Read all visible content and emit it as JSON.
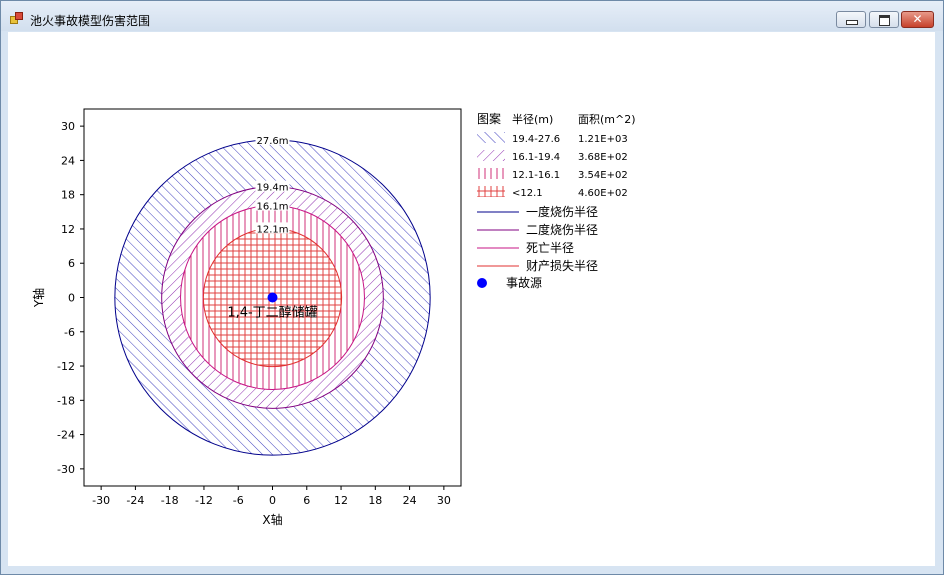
{
  "window": {
    "title": "池火事故模型伤害范围",
    "buttons": {
      "minimize_icon": "minimize-icon",
      "maximize_icon": "restore-icon",
      "close_icon": "close-icon"
    }
  },
  "chart_data": {
    "type": "area",
    "xlabel": "X轴",
    "ylabel": "Y轴",
    "xlim": [
      -33,
      33
    ],
    "ylim": [
      -33,
      33
    ],
    "xticks": [
      -30,
      -24,
      -18,
      -12,
      -6,
      0,
      6,
      12,
      18,
      24,
      30
    ],
    "yticks": [
      -30,
      -24,
      -18,
      -12,
      -6,
      0,
      6,
      12,
      18,
      24,
      30
    ],
    "grid": false,
    "source": {
      "x": 0,
      "y": 0,
      "label": "1,4-丁二醇储罐",
      "color": "#0000ff"
    },
    "circles": [
      {
        "radius": 27.6,
        "label": "27.6m",
        "color": "#00008b",
        "hatch": "diag-blue"
      },
      {
        "radius": 19.4,
        "label": "19.4m",
        "color": "#800080",
        "hatch": "diag-purple"
      },
      {
        "radius": 16.1,
        "label": "16.1m",
        "color": "#c71585",
        "hatch": "vertical"
      },
      {
        "radius": 12.1,
        "label": "12.1m",
        "color": "#e03030",
        "hatch": "grid"
      }
    ],
    "legend": {
      "position": "right",
      "header": {
        "pattern": "图案",
        "radius": "半径(m)",
        "area": "面积(m^2)"
      },
      "zones": [
        {
          "range": "19.4-27.6",
          "area": "1.21E+03",
          "hatch": "diag-blue"
        },
        {
          "range": "16.1-19.4",
          "area": "3.68E+02",
          "hatch": "diag-purple"
        },
        {
          "range": "12.1-16.1",
          "area": "3.54E+02",
          "hatch": "vertical"
        },
        {
          "range": "<12.1",
          "area": "4.60E+02",
          "hatch": "grid"
        }
      ],
      "lines": [
        {
          "label": "一度烧伤半径",
          "color": "#00008b"
        },
        {
          "label": "二度烧伤半径",
          "color": "#800080"
        },
        {
          "label": "死亡半径",
          "color": "#c71585"
        },
        {
          "label": "财产损失半径",
          "color": "#e03030"
        }
      ],
      "marker": {
        "label": "事故源",
        "color": "#0000ff"
      }
    }
  }
}
